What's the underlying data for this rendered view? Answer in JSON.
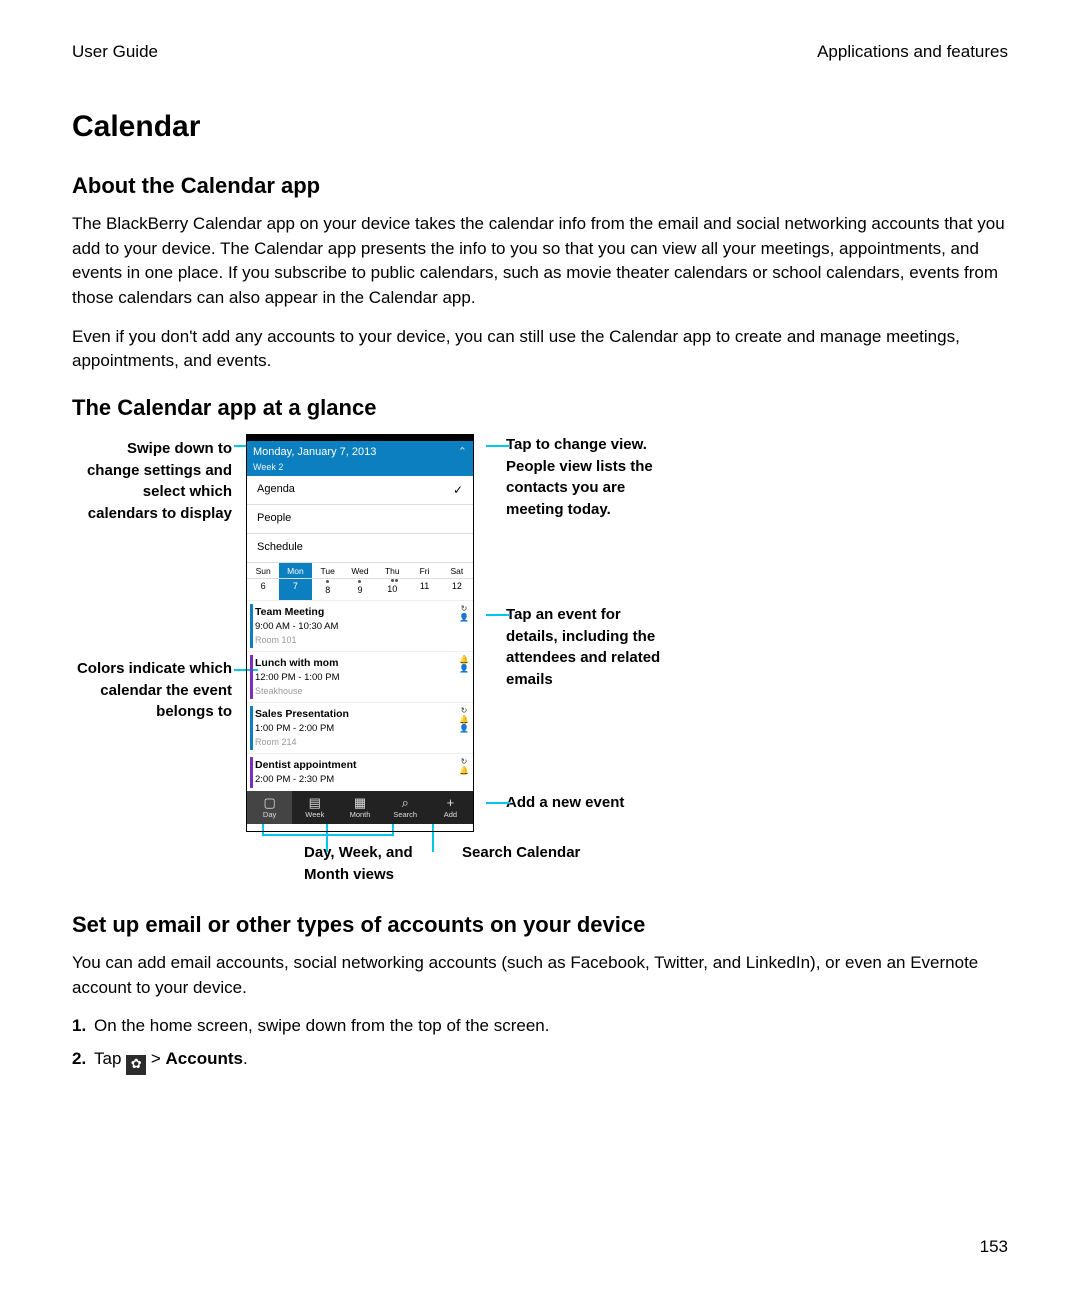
{
  "header": {
    "left": "User Guide",
    "right": "Applications and features"
  },
  "title": "Calendar",
  "section_about": {
    "heading": "About the Calendar app",
    "p1": "The BlackBerry Calendar app on your device takes the calendar info from the email and social networking accounts that you add to your device. The Calendar app presents the info to you so that you can view all your meetings, appointments, and events in one place. If you subscribe to public calendars, such as movie theater calendars or school calendars, events from those calendars can also appear in the Calendar app.",
    "p2": "Even if you don't add any accounts to your device, you can still use the Calendar app to create and manage meetings, appointments, and events."
  },
  "section_glance": {
    "heading": "The Calendar app at a glance",
    "callouts": {
      "left1": "Swipe down to change settings and select which calendars to display",
      "left2": "Colors indicate which calendar the event belongs to",
      "right1": "Tap to change view. People view lists the contacts you are meeting today.",
      "right2": "Tap an event for details, including the attendees and related emails",
      "right3": "Add a new event",
      "bottom1": "Day, Week, and Month views",
      "bottom2": "Search Calendar"
    }
  },
  "phone": {
    "date": "Monday, January 7, 2013",
    "week": "Week 2",
    "menu": [
      "Agenda",
      "People",
      "Schedule"
    ],
    "weekdays": [
      "Sun",
      "Mon",
      "Tue",
      "Wed",
      "Thu",
      "Fri",
      "Sat"
    ],
    "weeknums": [
      "6",
      "7",
      "8",
      "9",
      "10",
      "11",
      "12"
    ],
    "events": [
      {
        "title": "Team Meeting",
        "time": "9:00 AM - 10:30 AM",
        "loc": "Room 101",
        "color": "#0b7fbf"
      },
      {
        "title": "Lunch with mom",
        "time": "12:00 PM - 1:00 PM",
        "loc": "Steakhouse",
        "color": "#7b2fbf"
      },
      {
        "title": "Sales Presentation",
        "time": "1:00 PM - 2:00 PM",
        "loc": "Room 214",
        "color": "#0b7fbf"
      },
      {
        "title": "Dentist appointment",
        "time": "2:00 PM - 2:30 PM",
        "loc": "",
        "color": "#7b2fbf"
      }
    ],
    "bottombar": [
      {
        "label": "Day",
        "icon": "▢"
      },
      {
        "label": "Week",
        "icon": "▤"
      },
      {
        "label": "Month",
        "icon": "▦"
      },
      {
        "label": "Search",
        "icon": "⌕"
      },
      {
        "label": "Add",
        "icon": "+"
      }
    ]
  },
  "section_setup": {
    "heading": "Set up email or other types of accounts on your device",
    "p1": "You can add email accounts, social networking accounts (such as Facebook, Twitter, and LinkedIn), or even an Evernote account to your device.",
    "steps": {
      "1": "On the home screen, swipe down from the top of the screen.",
      "2a": "Tap ",
      "2b": " > ",
      "2c": "Accounts",
      "2d": "."
    }
  },
  "page": "153"
}
